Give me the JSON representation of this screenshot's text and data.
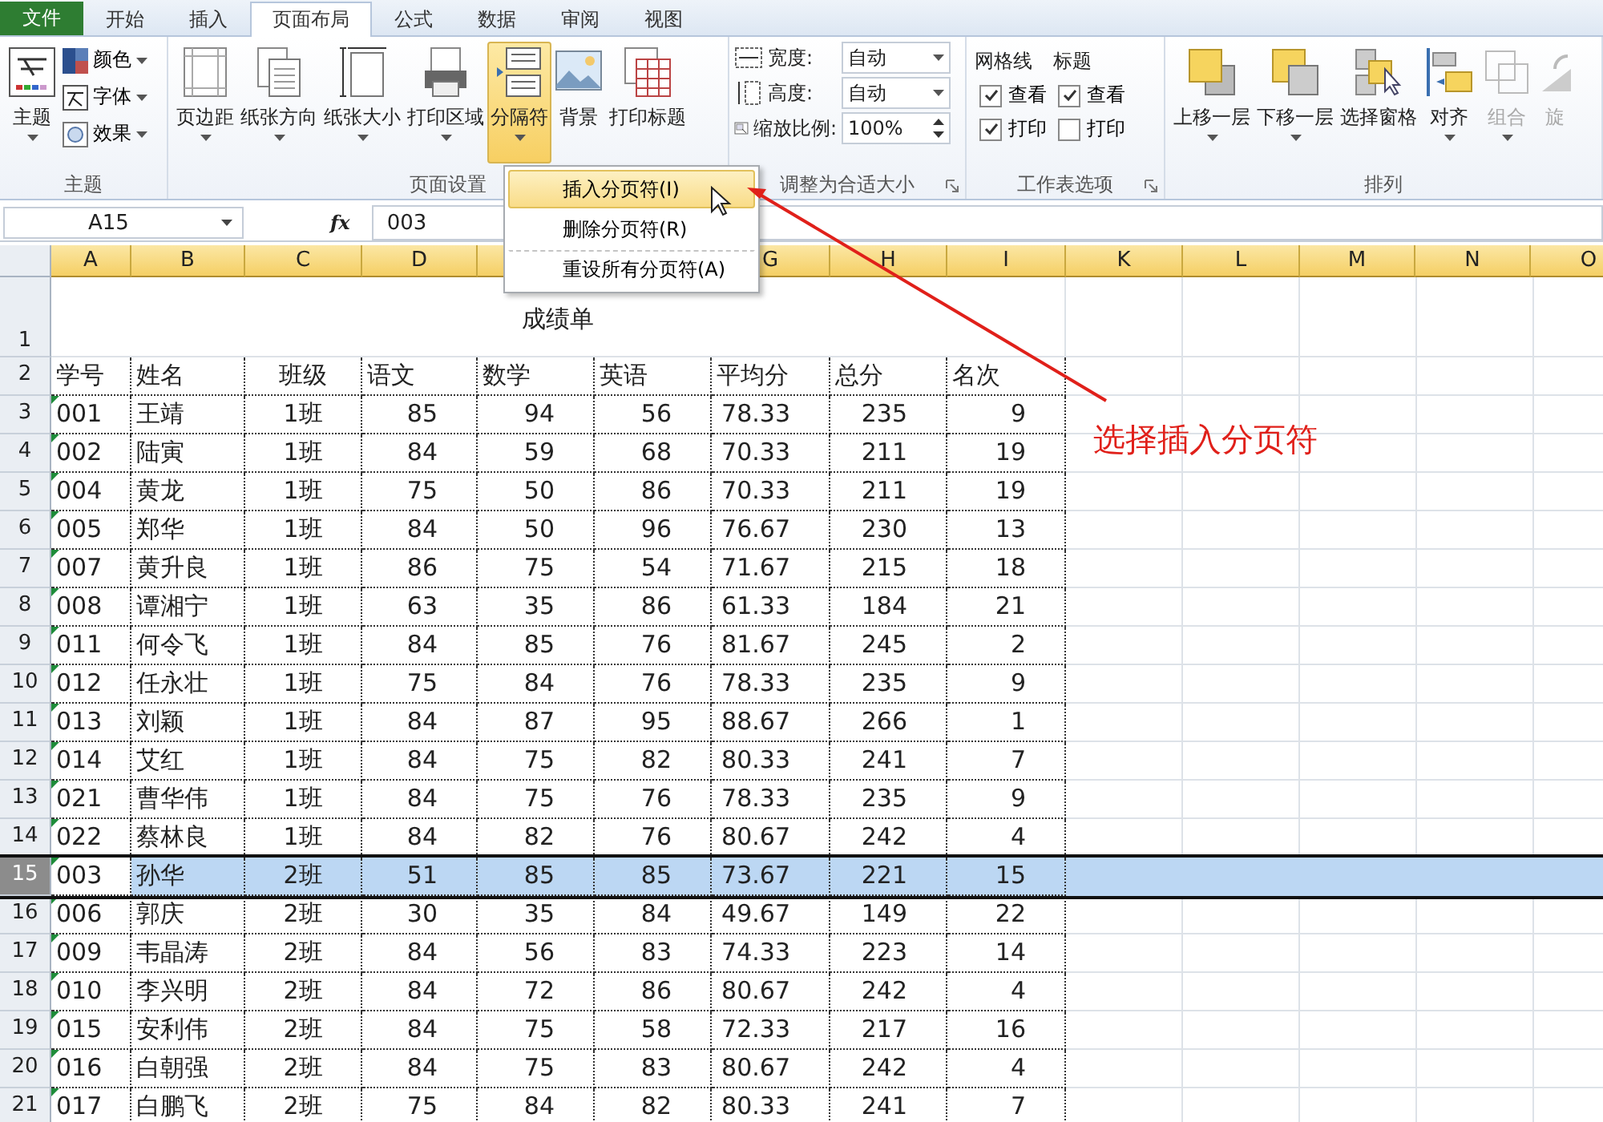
{
  "tabs": [
    {
      "label": "文件",
      "kind": "file",
      "selected": false
    },
    {
      "label": "开始",
      "kind": "tab",
      "selected": false
    },
    {
      "label": "插入",
      "kind": "tab",
      "selected": false
    },
    {
      "label": "页面布局",
      "kind": "tab",
      "selected": true
    },
    {
      "label": "公式",
      "kind": "tab",
      "selected": false
    },
    {
      "label": "数据",
      "kind": "tab",
      "selected": false
    },
    {
      "label": "审阅",
      "kind": "tab",
      "selected": false
    },
    {
      "label": "视图",
      "kind": "tab",
      "selected": false
    }
  ],
  "ribbon": {
    "groups": [
      {
        "label": "主题",
        "launcher": false,
        "items": [
          {
            "kind": "large",
            "label": "主题",
            "dropdown": true,
            "pressed": false,
            "disabled": false
          },
          {
            "kind": "stack",
            "items": [
              {
                "label": "颜色",
                "dropdown": true
              },
              {
                "label": "字体",
                "dropdown": true
              },
              {
                "label": "效果",
                "dropdown": true
              }
            ]
          }
        ]
      },
      {
        "label": "页面设置",
        "launcher": false,
        "items": [
          {
            "kind": "large",
            "label": "页边距",
            "dropdown": true,
            "pressed": false,
            "disabled": false
          },
          {
            "kind": "large",
            "label": "纸张方向",
            "dropdown": true,
            "pressed": false,
            "disabled": false
          },
          {
            "kind": "large",
            "label": "纸张大小",
            "dropdown": true,
            "pressed": false,
            "disabled": false
          },
          {
            "kind": "large",
            "label": "打印区域",
            "dropdown": true,
            "pressed": false,
            "disabled": false
          },
          {
            "kind": "large",
            "label": "分隔符",
            "dropdown": true,
            "pressed": true,
            "disabled": false
          },
          {
            "kind": "large",
            "label": "背景",
            "dropdown": false,
            "pressed": false,
            "disabled": false
          },
          {
            "kind": "large",
            "label": "打印标题",
            "dropdown": false,
            "pressed": false,
            "disabled": false
          }
        ]
      },
      {
        "label": "调整为合适大小",
        "launcher": true,
        "items": [
          {
            "kind": "fields",
            "rows": [
              {
                "label": "宽度:",
                "value": "自动",
                "kind": "dropdown"
              },
              {
                "label": "高度:",
                "value": "自动",
                "kind": "dropdown"
              },
              {
                "label": "缩放比例:",
                "value": "100%",
                "kind": "spin"
              }
            ]
          }
        ]
      },
      {
        "label": "工作表选项",
        "launcher": true,
        "items": [
          {
            "kind": "checks",
            "title": "网格线",
            "checks": [
              {
                "label": "查看",
                "checked": true
              },
              {
                "label": "打印",
                "checked": true
              }
            ]
          },
          {
            "kind": "checks",
            "title": "标题",
            "checks": [
              {
                "label": "查看",
                "checked": true
              },
              {
                "label": "打印",
                "checked": false
              }
            ]
          }
        ]
      },
      {
        "label": "排列",
        "launcher": false,
        "items": [
          {
            "kind": "large",
            "label": "上移一层",
            "dropdown": true,
            "pressed": false,
            "disabled": false
          },
          {
            "kind": "large",
            "label": "下移一层",
            "dropdown": true,
            "pressed": false,
            "disabled": false
          },
          {
            "kind": "large",
            "label": "选择窗格",
            "dropdown": false,
            "pressed": false,
            "disabled": false
          },
          {
            "kind": "large",
            "label": "对齐",
            "dropdown": true,
            "pressed": false,
            "disabled": false
          },
          {
            "kind": "large",
            "label": "组合",
            "dropdown": true,
            "pressed": false,
            "disabled": true
          },
          {
            "kind": "large",
            "label": "旋",
            "dropdown": false,
            "pressed": false,
            "disabled": true
          }
        ]
      }
    ]
  },
  "menu": {
    "items": [
      {
        "label": "插入分页符(I)",
        "selected": true,
        "separator_before": false
      },
      {
        "label": "删除分页符(R)",
        "selected": false,
        "separator_before": false
      },
      {
        "label": "重设所有分页符(A)",
        "selected": false,
        "separator_before": true
      }
    ]
  },
  "formula_bar": {
    "name_box": "A15",
    "fx": "fx",
    "formula": "003"
  },
  "sheet": {
    "columns": [
      {
        "header": "A"
      },
      {
        "header": "B"
      },
      {
        "header": "C"
      },
      {
        "header": "D"
      },
      {},
      {},
      {
        "header": "G"
      },
      {
        "header": "H"
      },
      {
        "header": "I"
      },
      {
        "header": "K"
      },
      {
        "header": "L"
      },
      {
        "header": "M"
      },
      {
        "header": "N"
      },
      {
        "header": "O"
      }
    ],
    "rows": [
      {
        "header": "1",
        "kind": "title",
        "title": "成绩单",
        "selected": false
      },
      {
        "header": "2",
        "kind": "header",
        "selected": false,
        "cells": [
          "学号",
          "姓名",
          "班级",
          "语文",
          "数学",
          "英语",
          "平均分",
          "总分",
          "名次"
        ]
      },
      {
        "header": "3",
        "kind": "data",
        "selected": false,
        "cells": [
          "001",
          "王靖",
          "1班",
          "85",
          "94",
          "56",
          "78.33",
          "235",
          "9"
        ]
      },
      {
        "header": "4",
        "kind": "data",
        "selected": false,
        "cells": [
          "002",
          "陆寅",
          "1班",
          "84",
          "59",
          "68",
          "70.33",
          "211",
          "19"
        ]
      },
      {
        "header": "5",
        "kind": "data",
        "selected": false,
        "cells": [
          "004",
          "黄龙",
          "1班",
          "75",
          "50",
          "86",
          "70.33",
          "211",
          "19"
        ]
      },
      {
        "header": "6",
        "kind": "data",
        "selected": false,
        "cells": [
          "005",
          "郑华",
          "1班",
          "84",
          "50",
          "96",
          "76.67",
          "230",
          "13"
        ]
      },
      {
        "header": "7",
        "kind": "data",
        "selected": false,
        "cells": [
          "007",
          "黄升良",
          "1班",
          "86",
          "75",
          "54",
          "71.67",
          "215",
          "18"
        ]
      },
      {
        "header": "8",
        "kind": "data",
        "selected": false,
        "cells": [
          "008",
          "谭湘宁",
          "1班",
          "63",
          "35",
          "86",
          "61.33",
          "184",
          "21"
        ]
      },
      {
        "header": "9",
        "kind": "data",
        "selected": false,
        "cells": [
          "011",
          "何令飞",
          "1班",
          "84",
          "85",
          "76",
          "81.67",
          "245",
          "2"
        ]
      },
      {
        "header": "10",
        "kind": "data",
        "selected": false,
        "cells": [
          "012",
          "任永壮",
          "1班",
          "75",
          "84",
          "76",
          "78.33",
          "235",
          "9"
        ]
      },
      {
        "header": "11",
        "kind": "data",
        "selected": false,
        "cells": [
          "013",
          "刘颖",
          "1班",
          "84",
          "87",
          "95",
          "88.67",
          "266",
          "1"
        ]
      },
      {
        "header": "12",
        "kind": "data",
        "selected": false,
        "cells": [
          "014",
          "艾红",
          "1班",
          "84",
          "75",
          "82",
          "80.33",
          "241",
          "7"
        ]
      },
      {
        "header": "13",
        "kind": "data",
        "selected": false,
        "cells": [
          "021",
          "曹华伟",
          "1班",
          "84",
          "75",
          "76",
          "78.33",
          "235",
          "9"
        ]
      },
      {
        "header": "14",
        "kind": "data",
        "selected": false,
        "cells": [
          "022",
          "蔡林良",
          "1班",
          "84",
          "82",
          "76",
          "80.67",
          "242",
          "4"
        ]
      },
      {
        "header": "15",
        "kind": "data",
        "selected": true,
        "cells": [
          "003",
          "孙华",
          "2班",
          "51",
          "85",
          "85",
          "73.67",
          "221",
          "15"
        ]
      },
      {
        "header": "16",
        "kind": "data",
        "selected": false,
        "cells": [
          "006",
          "郭庆",
          "2班",
          "30",
          "35",
          "84",
          "49.67",
          "149",
          "22"
        ]
      },
      {
        "header": "17",
        "kind": "data",
        "selected": false,
        "cells": [
          "009",
          "韦晶涛",
          "2班",
          "84",
          "56",
          "83",
          "74.33",
          "223",
          "14"
        ]
      },
      {
        "header": "18",
        "kind": "data",
        "selected": false,
        "cells": [
          "010",
          "李兴明",
          "2班",
          "84",
          "72",
          "86",
          "80.67",
          "242",
          "4"
        ]
      },
      {
        "header": "19",
        "kind": "data",
        "selected": false,
        "cells": [
          "015",
          "安利伟",
          "2班",
          "84",
          "75",
          "58",
          "72.33",
          "217",
          "16"
        ]
      },
      {
        "header": "20",
        "kind": "data",
        "selected": false,
        "cells": [
          "016",
          "白朝强",
          "2班",
          "84",
          "75",
          "83",
          "80.67",
          "242",
          "4"
        ]
      },
      {
        "header": "21",
        "kind": "data",
        "selected": false,
        "cells": [
          "017",
          "白鹏飞",
          "2班",
          "75",
          "84",
          "82",
          "80.33",
          "241",
          "7"
        ]
      }
    ]
  },
  "annotation": {
    "text": "选择插入分页符"
  }
}
